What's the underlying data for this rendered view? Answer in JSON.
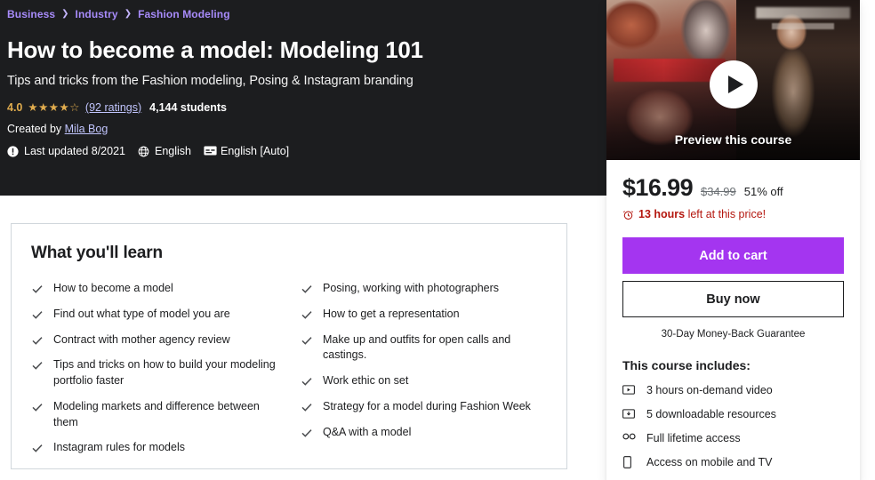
{
  "hero": {
    "breadcrumb": [
      "Business",
      "Industry",
      "Fashion Modeling"
    ],
    "title": "How to become a model: Modeling 101",
    "subtitle": "Tips and tricks from the Fashion modeling, Posing & Instagram branding",
    "rating": {
      "score": "4.0",
      "stars_filled": 4,
      "stars_total": 5,
      "ratings_link": "(92 ratings)",
      "students": "4,144 students",
      "star_color": "#e0ac4e"
    },
    "created_by_prefix": "Created by",
    "instructor": "Mila Bog",
    "meta": [
      {
        "icon": "info-circle-icon",
        "label": "Last updated 8/2021"
      },
      {
        "icon": "globe-icon",
        "label": "English"
      },
      {
        "icon": "closed-caption-icon",
        "label": "English [Auto]"
      }
    ],
    "background": "#1c1d1f"
  },
  "learn": {
    "title": "What you'll learn",
    "left_items": [
      "How to become a model",
      "Find out what type of model you are",
      "Contract with mother agency review",
      "Tips and tricks on how to build your modeling portfolio faster",
      "Modeling markets and difference between them",
      "Instagram rules for models"
    ],
    "right_items": [
      "Posing, working with photographers",
      "How to get a representation",
      "Make up and outfits for open calls and castings.",
      "Work ethic on set",
      "Strategy for a model during Fashion Week",
      "Q&A with a model"
    ]
  },
  "sidebar": {
    "preview_label": "Preview this course",
    "play_icon": "play-icon",
    "price_now": "$16.99",
    "price_old": "$34.99",
    "price_off": "51% off",
    "deal_icon": "alarm-clock-icon",
    "deal_bold": "13 hours",
    "deal_rest": " left at this price!",
    "add_to_cart_label": "Add to cart",
    "buy_now_label": "Buy now",
    "guarantee": "30-Day Money-Back Guarantee",
    "includes_title": "This course includes:",
    "includes": [
      {
        "icon": "video-play-box-icon",
        "label": "3 hours on-demand video"
      },
      {
        "icon": "download-box-icon",
        "label": "5 downloadable resources"
      },
      {
        "icon": "infinity-icon",
        "label": "Full lifetime access"
      },
      {
        "icon": "mobile-device-icon",
        "label": "Access on mobile and TV"
      }
    ],
    "accent_color": "#a435f0",
    "deal_color": "#b4170f"
  }
}
